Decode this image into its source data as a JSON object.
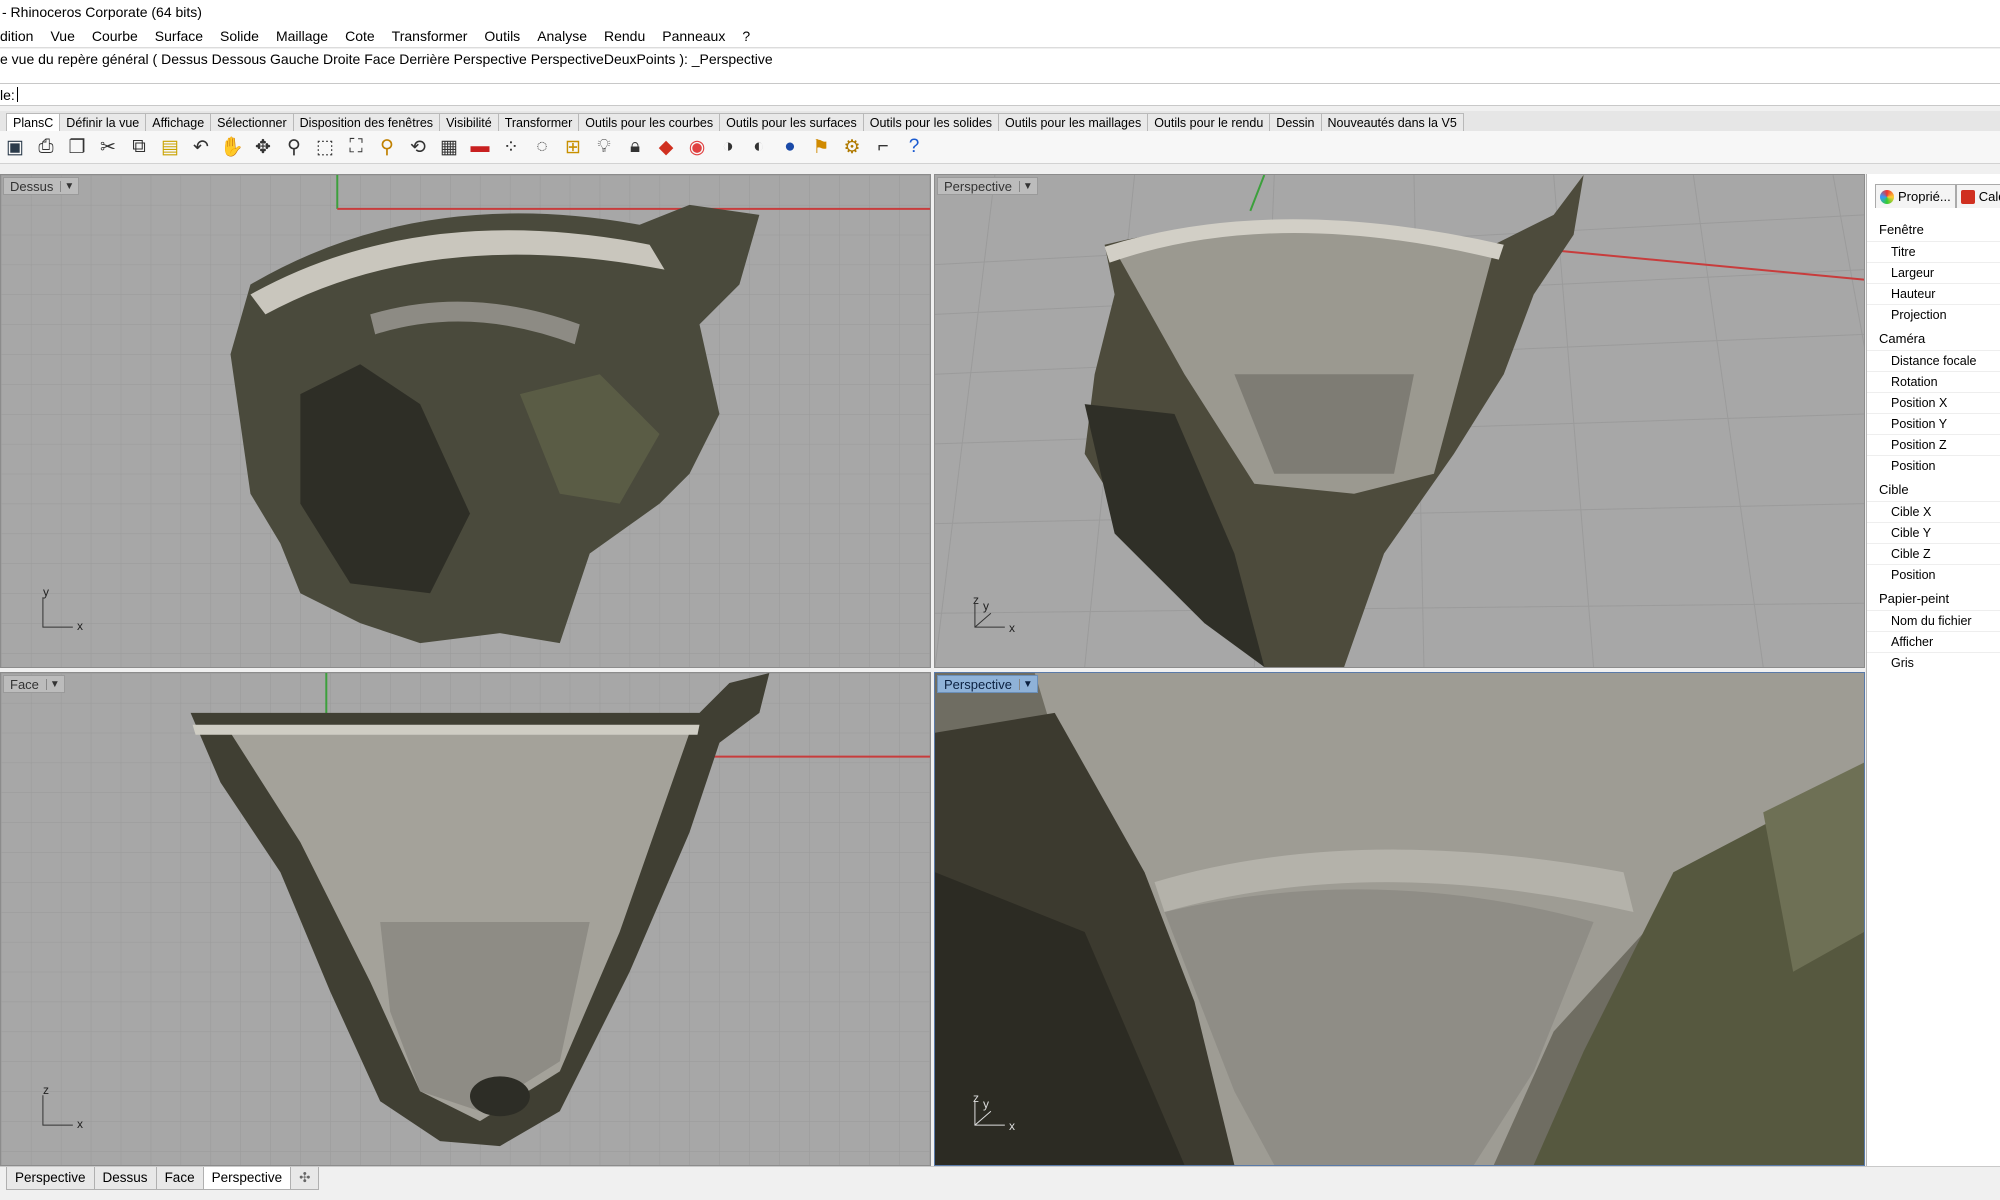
{
  "window": {
    "title": "- Rhinoceros Corporate (64 bits)"
  },
  "menu": [
    "dition",
    "Vue",
    "Courbe",
    "Surface",
    "Solide",
    "Maillage",
    "Cote",
    "Transformer",
    "Outils",
    "Analyse",
    "Rendu",
    "Panneaux",
    "?"
  ],
  "history_line": "e vue du repère général ( Dessus  Dessous  Gauche  Droite  Face  Derrière  Perspective  PerspectiveDeuxPoints ): _Perspective",
  "command_prompt": "le:",
  "toolbar_tabs": [
    "PlansC",
    "Définir la vue",
    "Affichage",
    "Sélectionner",
    "Disposition des fenêtres",
    "Visibilité",
    "Transformer",
    "Outils pour les courbes",
    "Outils pour les surfaces",
    "Outils pour les solides",
    "Outils pour les maillages",
    "Outils pour le rendu",
    "Dessin",
    "Nouveautés dans la V5"
  ],
  "toolbar_icons": [
    "save-icon",
    "print-icon",
    "import-icon",
    "cut-icon",
    "copy-icon",
    "paste-icon",
    "undo-icon",
    "pan-icon",
    "move-view-icon",
    "zoom-icon",
    "zoom-window-icon",
    "zoom-extents-icon",
    "zoom-selected-icon",
    "rotate-view-icon",
    "four-viewports-icon",
    "car-icon",
    "dots-icon",
    "circle-icon",
    "snap-icon",
    "light-bulb-icon",
    "lock-icon",
    "layer-icon",
    "color-wheel-icon",
    "shaded-sphere-icon",
    "rendered-sphere-icon",
    "blue-sphere-icon",
    "render-icon",
    "options-gear-icon",
    "fillet-icon",
    "help-icon"
  ],
  "viewports": [
    {
      "label": "Dessus",
      "active": false,
      "axes": [
        "y",
        "x"
      ]
    },
    {
      "label": "Perspective",
      "active": false,
      "axes": [
        "z",
        "y",
        "x"
      ]
    },
    {
      "label": "Face",
      "active": false,
      "axes": [
        "z",
        "x"
      ]
    },
    {
      "label": "Perspective",
      "active": true,
      "axes": [
        "z",
        "y",
        "x"
      ]
    }
  ],
  "panel": {
    "tabs": [
      "Proprié...",
      "Calq"
    ],
    "sections": [
      {
        "title": "Fenêtre",
        "rows": [
          "Titre",
          "Largeur",
          "Hauteur",
          "Projection"
        ]
      },
      {
        "title": "Caméra",
        "rows": [
          "Distance focale",
          "Rotation",
          "Position X",
          "Position Y",
          "Position Z",
          "Position"
        ]
      },
      {
        "title": "Cible",
        "rows": [
          "Cible X",
          "Cible Y",
          "Cible Z",
          "Position"
        ]
      },
      {
        "title": "Papier-peint",
        "rows": [
          "Nom du fichier",
          "Afficher",
          "Gris"
        ]
      }
    ]
  },
  "bottom_tabs": [
    "Perspective",
    "Dessus",
    "Face",
    "Perspective"
  ],
  "bottom_add": "✣",
  "colors": {
    "viewport_bg": "#a7a7a7",
    "grid_line": "#999999",
    "x_axis": "#c83c3c",
    "y_axis": "#3ca03c",
    "active_label": "#8fb2d8"
  }
}
